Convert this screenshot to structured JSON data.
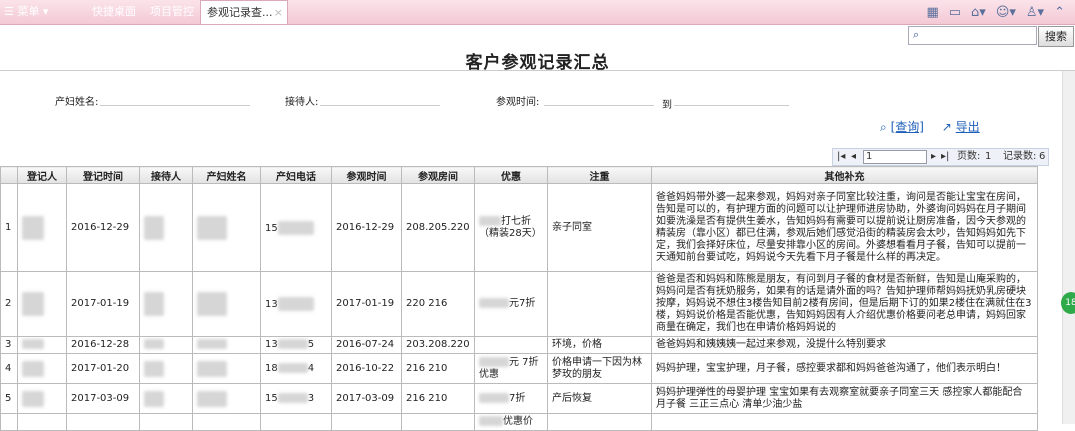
{
  "topbar": {
    "menu_label": "菜单",
    "tabs": [
      {
        "label": "快捷桌面"
      },
      {
        "label": "项目管控"
      },
      {
        "label": "参观记录查..."
      }
    ],
    "active_tab_close": "×"
  },
  "search": {
    "button_label": "搜索",
    "placeholder": ""
  },
  "page": {
    "title": "客户参观记录汇总"
  },
  "filters": {
    "name_label": "产妇姓名:",
    "receptionist_label": "接待人:",
    "visit_time_label": "参观时间:",
    "to_label": "到"
  },
  "actions": {
    "query_label": "[查询]",
    "export_label": "导出"
  },
  "pager": {
    "current_page": "1",
    "pages_label": "页数:",
    "pages_value": "1",
    "records_label": "记录数:",
    "records_value": "6"
  },
  "table": {
    "headers": [
      "",
      "登记人",
      "登记时间",
      "接待人",
      "产妇姓名",
      "产妇电话",
      "参观时间",
      "参观房间",
      "优惠",
      "注重",
      "其他补充"
    ],
    "rows": [
      {
        "no": "1",
        "reg_time": "2016-12-29",
        "phone_prefix": "15",
        "visit_time": "2016-12-29",
        "room": "208.205.220",
        "discount": "打七折（精装28天）",
        "focus": "亲子同室",
        "notes": "爸爸妈妈带外婆一起来参观，妈妈对亲子同室比较注重，询问是否能让宝宝在房间，告知是可以的，有护理方面的问题可以让护理师进房协助，外婆询问妈妈在月子期间如要洗澡是否有提供生姜水，告知妈妈有需要可以提前说让厨房准备，因今天参观的精装房（靠小区）都已住满，参观后她们感觉沿街的精装房会太吵，告知妈妈如先下定，我们会择好床位，尽量安排靠小区的房间。外婆想看看月子餐，告知可以提前一天通知前台要试吃，妈妈说今天先看下月子餐是什么样的再决定。"
      },
      {
        "no": "2",
        "reg_time": "2017-01-19",
        "phone_prefix": "13",
        "visit_time": "2017-01-19",
        "room": "220 216",
        "discount": "元7折",
        "focus": "",
        "notes": "爸爸是否和妈妈和陈熊是朋友，有问到月子餐的食材是否新鲜，告知是山庵采购的，妈妈问是否有抚奶服务，如果有的话是请外面的吗？告知护理师帮妈妈抚奶乳房硬块按摩，妈妈说不想住3楼告知目前2楼有房间，但是后期下订的如果2楼住在满就住在3楼，妈妈说价格是否能优惠，告知妈妈因有人介绍优惠价格要问老总申请，妈妈回家商量在确定，我们也在申请价格妈妈说的"
      },
      {
        "no": "3",
        "reg_time": "2016-12-28",
        "phone_prefix": "13",
        "phone_suffix": "5",
        "visit_time": "2016-07-24",
        "room": "203.208.220",
        "discount": "",
        "focus": "环境，价格",
        "notes": "爸爸妈妈和姨姨姨一起过来参观，没提什么特别要求"
      },
      {
        "no": "4",
        "reg_time": "2017-01-20",
        "phone_prefix": "18",
        "phone_suffix": "4",
        "visit_time": "2016-10-22",
        "room": "216 210",
        "discount": "元 7折优惠",
        "focus": "价格申请一下因为林梦玫的朋友",
        "notes": "妈妈护理，宝宝护理，月子餐，感控要求都和妈妈爸爸沟通了，他们表示明白！"
      },
      {
        "no": "5",
        "reg_time": "2017-03-09",
        "phone_prefix": "15",
        "phone_suffix": "3",
        "visit_time": "2017-03-09",
        "room": "216 210",
        "discount": "7折",
        "focus": "产后恢复",
        "notes": "妈妈护理弹性的母婴护理 宝宝如果有去观察室就要亲子同室三天 感控家人都能配合 月子餐 三正三点心 清单少油少盐"
      },
      {
        "no": "",
        "reg_time": "",
        "phone_prefix": "",
        "visit_time": "",
        "room": "",
        "discount": "优惠价",
        "focus": "",
        "notes": ""
      }
    ]
  },
  "float_badge": "18"
}
